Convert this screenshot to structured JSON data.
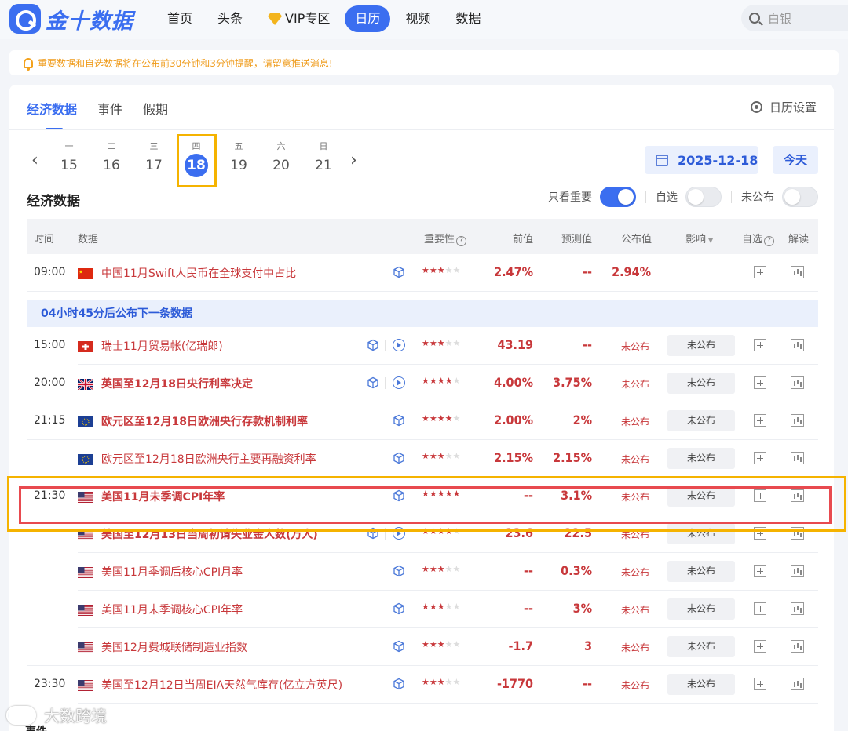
{
  "header": {
    "logo_text": "金十数据",
    "nav": [
      {
        "label": "首页",
        "active": false
      },
      {
        "label": "头条",
        "active": false
      },
      {
        "label": "VIP专区",
        "active": false
      },
      {
        "label": "日历",
        "active": true
      },
      {
        "label": "视频",
        "active": false
      },
      {
        "label": "数据",
        "active": false
      }
    ],
    "search_value": "白银"
  },
  "notice": "重要数据和自选数据将在公布前30分钟和3分钟提醒，请留意推送消息!",
  "tabs": [
    "经济数据",
    "事件",
    "假期"
  ],
  "settings_label": "日历设置",
  "week": [
    {
      "wd": "一",
      "day": "15"
    },
    {
      "wd": "二",
      "day": "16"
    },
    {
      "wd": "三",
      "day": "17"
    },
    {
      "wd": "四",
      "day": "18",
      "selected": true
    },
    {
      "wd": "五",
      "day": "19"
    },
    {
      "wd": "六",
      "day": "20"
    },
    {
      "wd": "日",
      "day": "21"
    }
  ],
  "date_value": "2025-12-18",
  "today_label": "今天",
  "section_title": "经济数据",
  "toggles": {
    "important": "只看重要",
    "favorites": "自选",
    "unpublished": "未公布"
  },
  "columns": {
    "time": "时间",
    "data": "数据",
    "importance": "重要性",
    "previous": "前值",
    "forecast": "预测值",
    "actual": "公布值",
    "impact": "影响",
    "favorite": "自选",
    "analysis": "解读"
  },
  "countdown": "04小时45分后公布下一条数据",
  "rows": [
    {
      "time": "09:00",
      "flag": "cn",
      "name": "中国11月Swift人民币在全球支付中占比",
      "bold": false,
      "play": false,
      "stars": 3,
      "previous": "2.47%",
      "forecast": "--",
      "actual": "2.94%",
      "unpub": "",
      "impact": ""
    },
    {
      "time": "15:00",
      "flag": "ch",
      "name": "瑞士11月贸易帐(亿瑞郎)",
      "bold": false,
      "play": true,
      "stars": 3,
      "previous": "43.19",
      "forecast": "--",
      "actual": "",
      "unpub": "未公布",
      "impact": "未公布"
    },
    {
      "time": "20:00",
      "flag": "uk",
      "name": "英国至12月18日央行利率决定",
      "bold": true,
      "play": true,
      "stars": 4,
      "previous": "4.00%",
      "forecast": "3.75%",
      "actual": "",
      "unpub": "未公布",
      "impact": "未公布"
    },
    {
      "time": "21:15",
      "flag": "eu",
      "name": "欧元区至12月18日欧洲央行存款机制利率",
      "bold": true,
      "play": false,
      "stars": 4,
      "previous": "2.00%",
      "forecast": "2%",
      "actual": "",
      "unpub": "未公布",
      "impact": "未公布"
    },
    {
      "time": "",
      "flag": "eu",
      "name": "欧元区至12月18日欧洲央行主要再融资利率",
      "bold": false,
      "play": false,
      "stars": 3,
      "previous": "2.15%",
      "forecast": "2.15%",
      "actual": "",
      "unpub": "未公布",
      "impact": "未公布"
    },
    {
      "time": "21:30",
      "flag": "us",
      "name": "美国11月未季调CPI年率",
      "bold": true,
      "play": false,
      "stars": 5,
      "previous": "--",
      "forecast": "3.1%",
      "actual": "",
      "unpub": "未公布",
      "impact": "未公布"
    },
    {
      "time": "",
      "flag": "us",
      "name": "美国至12月13日当周初请失业金人数(万人)",
      "bold": true,
      "play": true,
      "stars": 4,
      "previous": "23.6",
      "forecast": "22.5",
      "actual": "",
      "unpub": "未公布",
      "impact": "未公布"
    },
    {
      "time": "",
      "flag": "us",
      "name": "美国11月季调后核心CPI月率",
      "bold": false,
      "play": false,
      "stars": 3,
      "previous": "--",
      "forecast": "0.3%",
      "actual": "",
      "unpub": "未公布",
      "impact": "未公布"
    },
    {
      "time": "",
      "flag": "us",
      "name": "美国11月未季调核心CPI年率",
      "bold": false,
      "play": false,
      "stars": 3,
      "previous": "--",
      "forecast": "3%",
      "actual": "",
      "unpub": "未公布",
      "impact": "未公布"
    },
    {
      "time": "",
      "flag": "us",
      "name": "美国12月费城联储制造业指数",
      "bold": false,
      "play": false,
      "stars": 3,
      "previous": "-1.7",
      "forecast": "3",
      "actual": "",
      "unpub": "未公布",
      "impact": "未公布"
    },
    {
      "time": "23:30",
      "flag": "us",
      "name": "美国至12月12日当周EIA天然气库存(亿立方英尺)",
      "bold": false,
      "play": false,
      "stars": 3,
      "previous": "-1770",
      "forecast": "--",
      "actual": "",
      "unpub": "未公布",
      "impact": "未公布"
    }
  ],
  "watermark": "大数跨境",
  "bottom_label": "事件",
  "colors": {
    "accent": "#3b6ef0",
    "bullish": "#c8383b",
    "highlight_red": "#e84a4f",
    "highlight_yellow": "#f5b300"
  }
}
